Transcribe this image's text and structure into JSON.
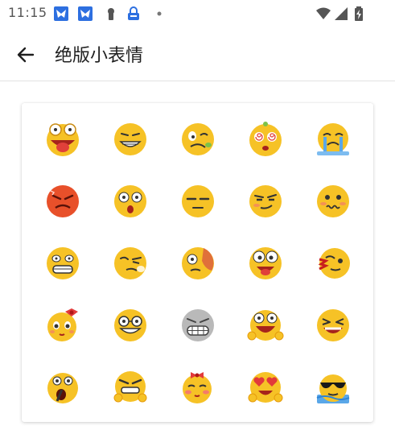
{
  "status_bar": {
    "time": "11:15",
    "left_icons": [
      "app-notification-icon",
      "app-notification-icon",
      "keyhole-icon",
      "vpn-lock-icon",
      "dot-icon"
    ],
    "right_icons": [
      "wifi-icon",
      "cellular-signal-icon",
      "battery-icon"
    ]
  },
  "app_bar": {
    "back_icon": "arrow-left-icon",
    "title": "绝版小表情"
  },
  "emoji_grid": {
    "rows": [
      [
        "tongue-out-emoji",
        "grin-emoji",
        "sick-face-emoji",
        "dizzy-face-emoji",
        "crying-emoji"
      ],
      [
        "angry-emoji",
        "shocked-emoji",
        "unamused-emoji",
        "smirk-emoji",
        "embarrassed-emoji"
      ],
      [
        "nervous-grin-emoji",
        "cheeky-emoji",
        "bruised-emoji",
        "silly-face-emoji",
        "nosebleed-emoji"
      ],
      [
        "bow-girl-emoji",
        "glasses-grin-emoji",
        "gray-grimace-emoji",
        "big-laugh-emoji",
        "squint-laugh-emoji"
      ],
      [
        "eating-emoji",
        "determined-emoji",
        "shy-bow-emoji",
        "heart-eyes-emoji",
        "sunglasses-emoji"
      ]
    ],
    "colors": {
      "face": "#f6c226",
      "face_shade": "#e59b0c",
      "angry": "#e8502a",
      "gray": "#b9b9b9",
      "blush": "#f47c6a",
      "tongue": "#e0403a",
      "tear": "#5aa7e8",
      "bow": "#e23a3a"
    }
  }
}
